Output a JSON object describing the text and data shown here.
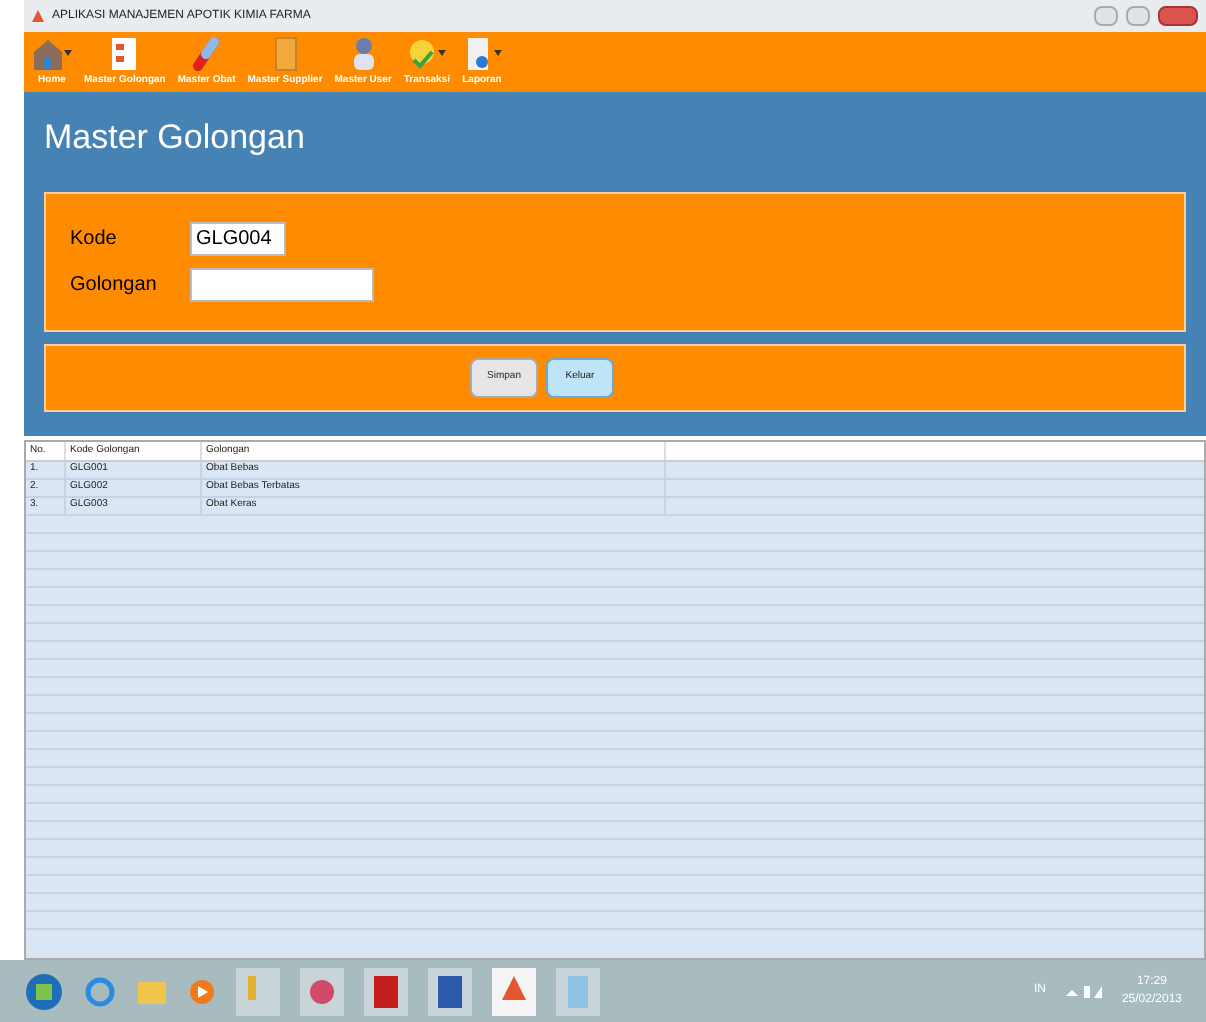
{
  "window": {
    "title": "APLIKASI MANAJEMEN APOTIK KIMIA FARMA"
  },
  "toolbar": [
    {
      "label": "Home",
      "kind": "home",
      "dropdown": true
    },
    {
      "label": "Master Golongan",
      "kind": "golongan",
      "dropdown": false
    },
    {
      "label": "Master Obat",
      "kind": "obat",
      "dropdown": false
    },
    {
      "label": "Master Supplier",
      "kind": "supplier",
      "dropdown": false
    },
    {
      "label": "Master User",
      "kind": "user",
      "dropdown": false
    },
    {
      "label": "Transaksi",
      "kind": "transaksi",
      "dropdown": true
    },
    {
      "label": "Laporan",
      "kind": "laporan",
      "dropdown": true
    }
  ],
  "form": {
    "title": "Master Golongan",
    "fields": [
      {
        "label": "Kode",
        "value": "GLG004"
      },
      {
        "label": "Golongan"
      }
    ],
    "buttons": [
      {
        "label": "Simpan",
        "selected": false
      },
      {
        "label": "Keluar",
        "selected": true
      }
    ]
  },
  "table": {
    "columns": [
      "No.",
      "Kode Golongan",
      "Golongan"
    ],
    "rows": [
      [
        "1.",
        "GLG001",
        "Obat Bebas"
      ],
      [
        "2.",
        "GLG002",
        "Obat Bebas Terbatas"
      ],
      [
        "3.",
        "GLG003",
        "Obat Keras"
      ]
    ]
  },
  "taskbar": {
    "language": "IN",
    "time": "17:29",
    "date": "25/02/2013"
  }
}
